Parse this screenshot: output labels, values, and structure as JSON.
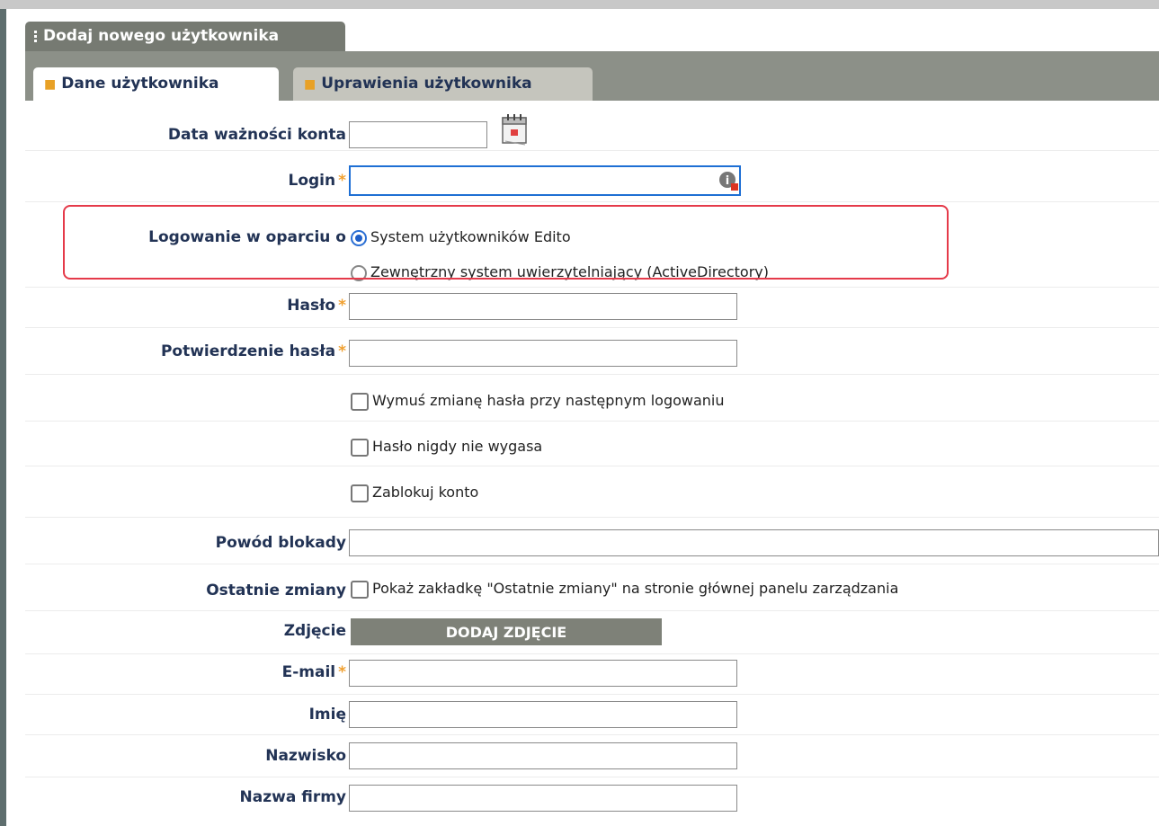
{
  "window": {
    "title": "Dodaj nowego użytkownika"
  },
  "tabs": [
    {
      "label": "Dane użytkownika",
      "active": true
    },
    {
      "label": "Uprawienia użytkownika",
      "active": false
    }
  ],
  "form": {
    "account_expiry": {
      "label": "Data ważności konta",
      "value": "",
      "icon": "calendar-icon"
    },
    "login": {
      "label": "Login",
      "value": "",
      "required": true,
      "icon": "info-icon"
    },
    "auth": {
      "label": "Logowanie w oparciu o",
      "options": [
        {
          "label": "System użytkowników Edito",
          "selected": true
        },
        {
          "label": "Zewnętrzny system uwierzytelniający (ActiveDirectory)",
          "selected": false
        }
      ]
    },
    "password": {
      "label": "Hasło",
      "value": "",
      "required": true
    },
    "password_confirm": {
      "label": "Potwierdzenie hasła",
      "value": "",
      "required": true
    },
    "options": [
      {
        "label": "Wymuś zmianę hasła przy następnym logowaniu",
        "checked": false
      },
      {
        "label": "Hasło nigdy nie wygasa",
        "checked": false
      },
      {
        "label": "Zablokuj konto",
        "checked": false
      }
    ],
    "block_reason": {
      "label": "Powód blokady",
      "value": ""
    },
    "recent_changes": {
      "label": "Ostatnie zmiany",
      "checkbox_label": "Pokaż zakładkę \"Ostatnie zmiany\" na stronie głównej panelu zarządzania",
      "checked": false
    },
    "photo": {
      "label": "Zdjęcie",
      "button_label": "DODAJ ZDJĘCIE"
    },
    "email": {
      "label": "E-mail",
      "value": "",
      "required": true
    },
    "first_name": {
      "label": "Imię",
      "value": ""
    },
    "last_name": {
      "label": "Nazwisko",
      "value": ""
    },
    "company": {
      "label": "Nazwa firmy",
      "value": ""
    }
  },
  "required_mark": "*",
  "colors": {
    "label": "#223355",
    "accent": "#e8a126",
    "focus": "#1e6fd4",
    "highlight": "#e53a4a",
    "tab_bar": "#8c9088"
  }
}
